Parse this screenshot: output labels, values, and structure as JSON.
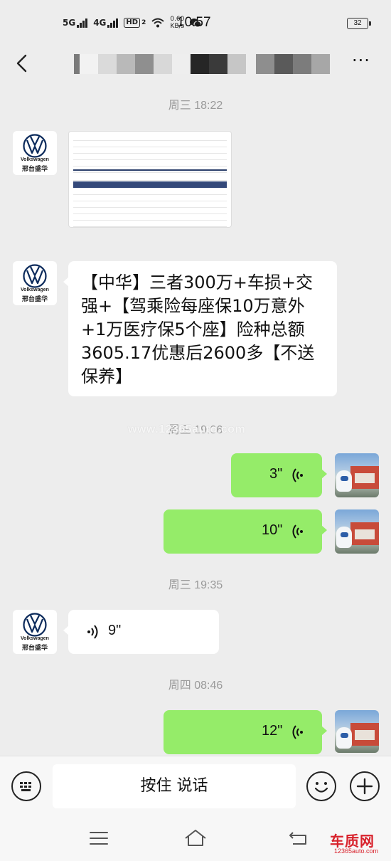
{
  "status_bar": {
    "net1": "5G",
    "net2": "4G",
    "hd": "HD",
    "hd_sub": "2",
    "speed_value": "0.60",
    "speed_unit": "KB/s",
    "time": "10:57",
    "battery": "32"
  },
  "header": {
    "title_blurred": true,
    "more": "···"
  },
  "contact": {
    "brand": "Volkswagen",
    "dealer": "邢台盛华"
  },
  "messages": {
    "ts1": "周三 18:22",
    "text_msg": "【中华】三者300万+车损+交强+【驾乘险每座保10万意外+1万医疗保5个座】险种总额3605.17优惠后2600多【不送保养】",
    "ts2": "周三 19:06",
    "voice1": "3\"",
    "voice2": "10\"",
    "ts3": "周三 19:35",
    "voice3": "9\"",
    "ts4": "周四 08:46",
    "voice4": "12\""
  },
  "watermark": "www.12365auto.com",
  "input_bar": {
    "hold_to_talk": "按住 说话"
  },
  "corner_logo": {
    "text": "车质网",
    "url": "12365auto.com"
  },
  "colors": {
    "my_bubble": "#95ec69",
    "their_bubble": "#ffffff",
    "background": "#ededed"
  }
}
